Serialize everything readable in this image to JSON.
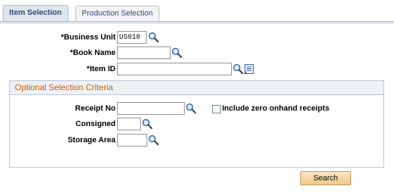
{
  "tabs": [
    {
      "label": "Item Selection",
      "active": true
    },
    {
      "label": "Production Selection",
      "active": false
    }
  ],
  "fields": {
    "business_unit": {
      "label": "Business Unit",
      "required": "*",
      "value": "US010"
    },
    "book_name": {
      "label": "Book Name",
      "required": "*",
      "value": ""
    },
    "item_id": {
      "label": "Item ID",
      "required": "*",
      "value": ""
    }
  },
  "optional_section": {
    "title": "Optional Selection Criteria",
    "receipt_no": {
      "label": "Receipt No",
      "value": ""
    },
    "include_zero": {
      "label": "Include zero onhand receipts",
      "checked": false
    },
    "consigned": {
      "label": "Consigned",
      "value": ""
    },
    "storage_area": {
      "label": "Storage Area",
      "value": ""
    }
  },
  "buttons": {
    "search": "Search"
  },
  "icons": {
    "lookup": "magnifier-icon",
    "detail": "detail-page-icon"
  },
  "colors": {
    "tab_text": "#33497b",
    "section_title": "#c85a00",
    "button_bg": "#f0c98b"
  }
}
